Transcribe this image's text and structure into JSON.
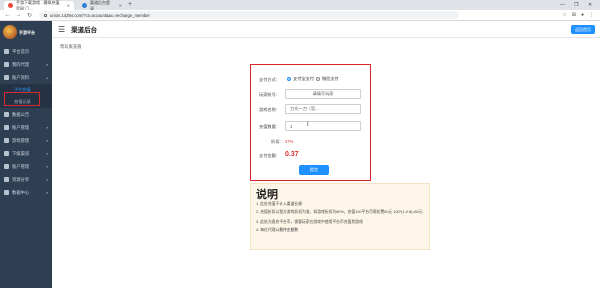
{
  "browser": {
    "tabs": [
      {
        "title": "手游下载游戏 - 模拟充值官网 门…"
      },
      {
        "title": "渠道后台登录"
      }
    ],
    "new_tab": "+",
    "window_controls": [
      "—",
      "❐",
      "✕"
    ],
    "url": "union.14294.com/?ct=account&ac=recharge_member"
  },
  "sidebar": {
    "logo_text": "手游平台",
    "items": [
      {
        "label": "平台首页",
        "icon": "home-icon"
      },
      {
        "label": "我的代理",
        "icon": "agent-icon"
      },
      {
        "label": "账户资料",
        "icon": "account-icon",
        "children": [
          {
            "label": "子代充值"
          },
          {
            "label": "充值记录"
          }
        ]
      },
      {
        "label": "数据公告",
        "icon": "notice-icon"
      },
      {
        "label": "账户管理",
        "icon": "wallet-icon"
      },
      {
        "label": "游戏管理",
        "icon": "game-icon"
      },
      {
        "label": "下级渠道",
        "icon": "channel-icon"
      },
      {
        "label": "账户管理",
        "icon": "user-icon"
      },
      {
        "label": "资源分享",
        "icon": "share-icon"
      },
      {
        "label": "数据中心",
        "icon": "data-icon"
      }
    ]
  },
  "header": {
    "title": "渠道后台",
    "back_button": "返回首页"
  },
  "breadcrumb": "帮玩家充值",
  "form": {
    "pay_method_label": "支付方式:",
    "pay_options": [
      "支付宝支付",
      "微信支付"
    ],
    "player_account_label": "玩家账号:",
    "player_account_value": "请填写玩家",
    "game_name_label": "游戏名称:",
    "game_name_value": "刀光一刀（官...",
    "amount_label": "充值数量:",
    "amount_value": "1",
    "discount_label": "折扣:",
    "discount_value": "37%",
    "total_label": "支付金额:",
    "total_value": "0.37",
    "submit": "提交"
  },
  "notice": {
    "title": "说明",
    "lines": [
      "1. 此处充值不计入渠道业绩",
      "2. 充值折扣以我方游戏折扣为准，如游戏折扣为80%，充值100平台币需花费80元 100*(1-0.8)=80元",
      "3. 此处为直充平台币，需要玩家在游戏中使用平台币充值到游戏",
      "4. 每位代理以最终金额数"
    ]
  },
  "colors": {
    "accent": "#1e90ff",
    "sidebar": "#2e3e53",
    "highlight": "#d9272e",
    "price": "#e03131"
  }
}
